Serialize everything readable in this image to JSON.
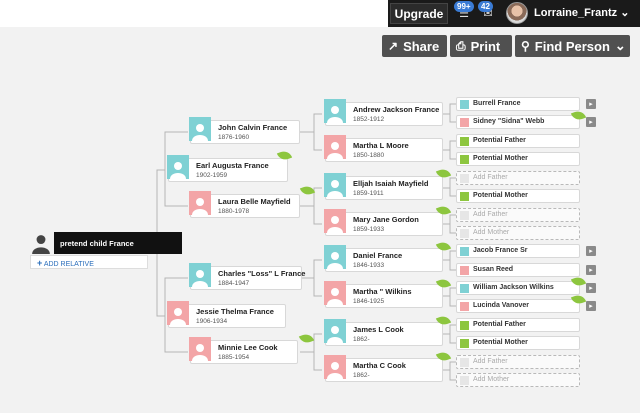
{
  "header": {
    "upgrade_label": "Upgrade",
    "notifications_badge": "99+",
    "messages_badge": "42",
    "username": "Lorraine_Frantz"
  },
  "toolbar": {
    "share_label": "Share",
    "print_label": "Print",
    "find_person_label": "Find Person"
  },
  "root": {
    "name": "pretend child France",
    "add_relative": "ADD RELATIVE"
  },
  "people": {
    "jcf": {
      "name": "John Calvin France",
      "dates": "1876-1960"
    },
    "ajf": {
      "name": "Andrew Jackson France",
      "dates": "1852-1912"
    },
    "mlm": {
      "name": "Martha L Moore",
      "dates": "1850-1880"
    },
    "eaf": {
      "name": "Earl Augusta France",
      "dates": "1902-1959"
    },
    "lbm": {
      "name": "Laura Belle Mayfield",
      "dates": "1880-1978"
    },
    "eim": {
      "name": "Elljah Isaiah Mayfield",
      "dates": "1859-1911"
    },
    "mjg": {
      "name": "Mary Jane Gordon",
      "dates": "1859-1933"
    },
    "df": {
      "name": "Daniel France",
      "dates": "1846-1933"
    },
    "clf": {
      "name": "Charles \"Loss\" L France",
      "dates": "1884-1947"
    },
    "mw": {
      "name": "Martha \" Wilkins",
      "dates": "1846-1925"
    },
    "jtf": {
      "name": "Jessie Thelma France",
      "dates": "1906-1934"
    },
    "jlc": {
      "name": "James L Cook",
      "dates": "1862-"
    },
    "mlc": {
      "name": "Minnie Lee Cook",
      "dates": "1885-1954"
    },
    "mcc": {
      "name": "Martha C Cook",
      "dates": "1862-"
    }
  },
  "ancestors": [
    {
      "label": "Burrell France"
    },
    {
      "label": "Sidney \"Sidna\" Webb"
    },
    {
      "label": "Potential Father"
    },
    {
      "label": "Potential Mother"
    },
    {
      "label": "Add Father"
    },
    {
      "label": "Potential Mother"
    },
    {
      "label": "Add Father"
    },
    {
      "label": "Add Mother"
    },
    {
      "label": "Jacob France Sr"
    },
    {
      "label": "Susan Reed"
    },
    {
      "label": "William Jackson Wilkins"
    },
    {
      "label": "Lucinda Vanover"
    },
    {
      "label": "Potential Father"
    },
    {
      "label": "Potential Mother"
    },
    {
      "label": "Add Father"
    },
    {
      "label": "Add Mother"
    }
  ],
  "colors": {
    "male": "#7fd1d4",
    "female": "#f3a5a7",
    "hint_leaf": "#8dc63f",
    "toolbar": "#505050",
    "topbar": "#1a1a1a",
    "link": "#2a6ebb"
  }
}
